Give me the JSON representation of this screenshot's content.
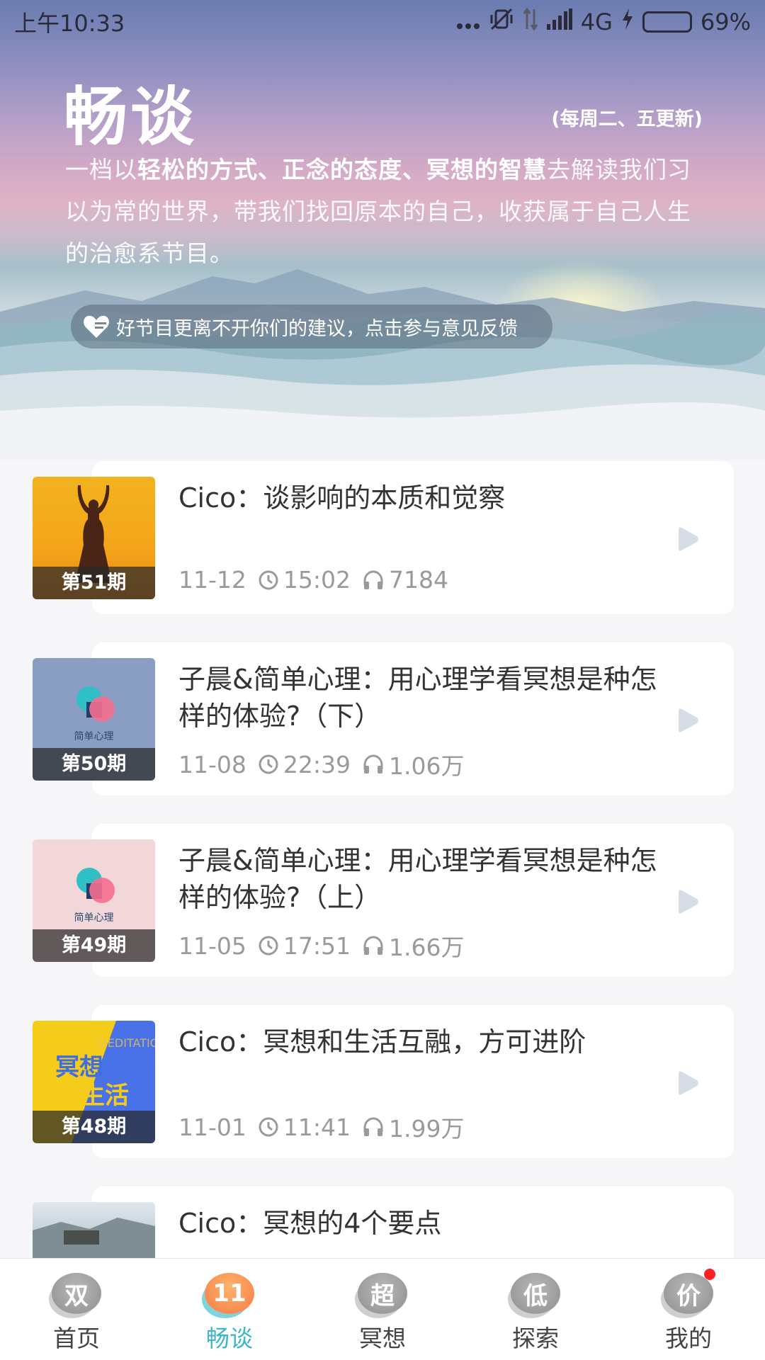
{
  "status_bar": {
    "time": "上午10:33",
    "network": "4G",
    "battery": "69%",
    "battery_level": 0.69
  },
  "header": {
    "title": "畅谈",
    "schedule": "(每周二、五更新)",
    "description": {
      "prefix": "一档以",
      "bold": "轻松的方式、正念的态度、冥想的智慧",
      "suffix": "去解读我们习以为常的世界，带我们找回原本的自己，收获属于自己人生的治愈系节目。"
    },
    "feedback": "好节目更离不开你们的建议，点击参与意见反馈"
  },
  "episodes": [
    {
      "issue": "第51期",
      "title": "Cico：谈影响的本质和觉察",
      "date": "11-12",
      "duration": "15:02",
      "plays": "7184",
      "cover_icon": "yoga-silhouette"
    },
    {
      "issue": "第50期",
      "title": "子晨&简单心理：用心理学看冥想是种怎样的体验?（下）",
      "date": "11-08",
      "duration": "22:39",
      "plays": "1.06万",
      "cover_label": "简单心理"
    },
    {
      "issue": "第49期",
      "title": "子晨&简单心理：用心理学看冥想是种怎样的体验?（上）",
      "date": "11-05",
      "duration": "17:51",
      "plays": "1.66万",
      "cover_label": "简单心理"
    },
    {
      "issue": "第48期",
      "title": "Cico：冥想和生活互融，方可进阶",
      "date": "11-01",
      "duration": "11:41",
      "plays": "1.99万",
      "cover_line1": "冥想",
      "cover_line2": "生活",
      "cover_sub": "MEDITATION"
    },
    {
      "issue": "",
      "title": "Cico：冥想的4个要点",
      "date": "",
      "duration": "",
      "plays": ""
    }
  ],
  "nav": {
    "items": [
      {
        "badge": "双",
        "label": "首页",
        "active": false
      },
      {
        "badge": "11",
        "label": "畅谈",
        "active": true
      },
      {
        "badge": "超",
        "label": "冥想",
        "active": false
      },
      {
        "badge": "低",
        "label": "探索",
        "active": false
      },
      {
        "badge": "价",
        "label": "我的",
        "active": false,
        "has_dot": true
      }
    ]
  },
  "colors": {
    "accent": "#3fb5c8",
    "notification_dot": "#ff2020",
    "meta_text": "#9a9a9e"
  }
}
